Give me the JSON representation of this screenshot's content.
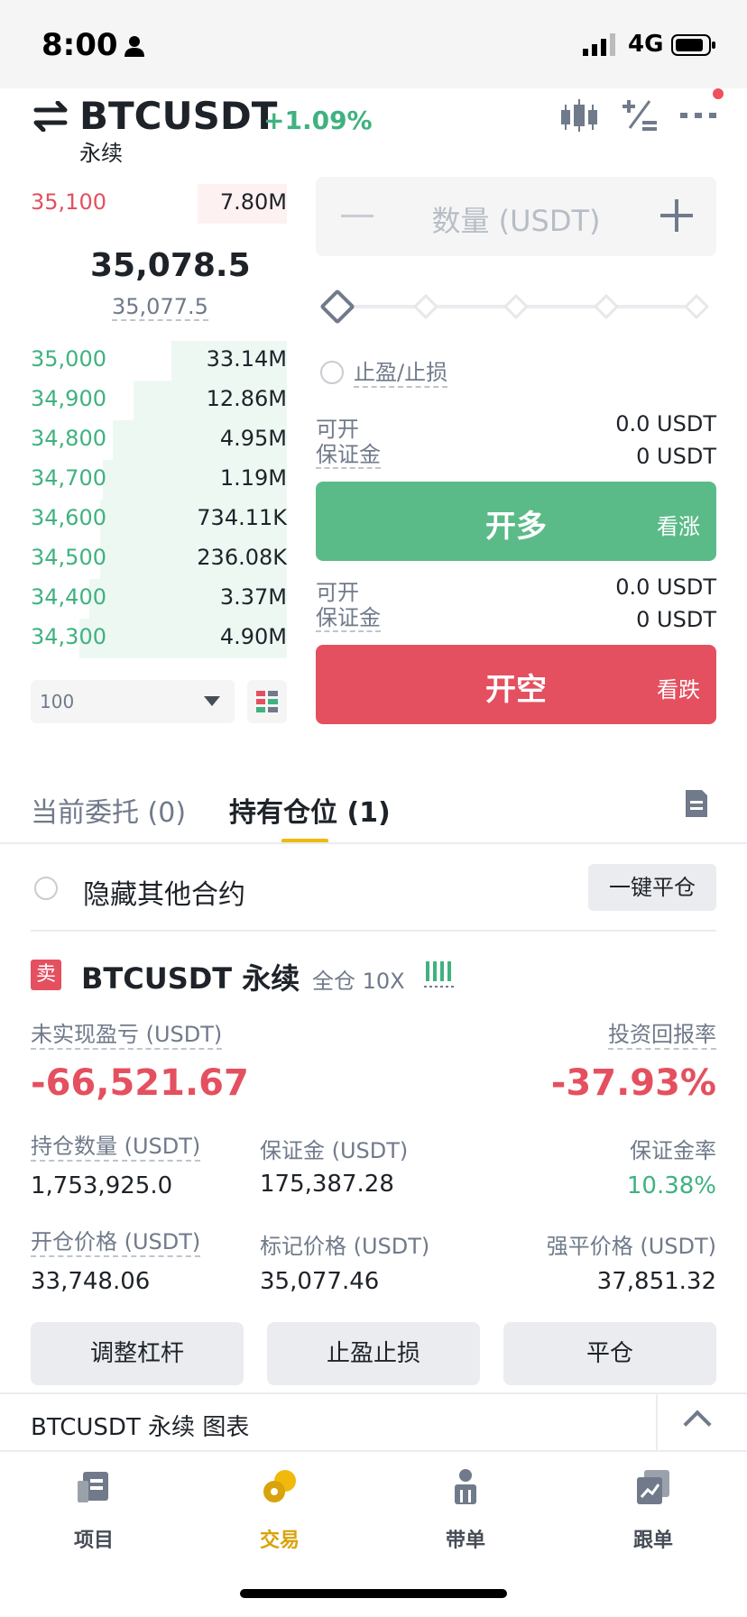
{
  "status_bar": {
    "time": "8:00",
    "network": "4G"
  },
  "header": {
    "symbol": "BTCUSDT",
    "change": "+1.09%",
    "contract_type": "永续"
  },
  "colors": {
    "green": "#3fb27f",
    "red": "#e4505f",
    "accent": "#f0b90b"
  },
  "order_book": {
    "asks": [
      {
        "price": "35,100",
        "qty": "7.80M",
        "depth": 0.5
      }
    ],
    "last_price": "35,078.5",
    "mark_price": "35,077.5",
    "bids": [
      {
        "price": "35,000",
        "qty": "33.14M",
        "depth": 0.45
      },
      {
        "price": "34,900",
        "qty": "12.86M",
        "depth": 0.6
      },
      {
        "price": "34,800",
        "qty": "4.95M",
        "depth": 0.68
      },
      {
        "price": "34,700",
        "qty": "1.19M",
        "depth": 0.72
      },
      {
        "price": "34,600",
        "qty": "734.11K",
        "depth": 0.73
      },
      {
        "price": "34,500",
        "qty": "236.08K",
        "depth": 0.73
      },
      {
        "price": "34,400",
        "qty": "3.37M",
        "depth": 0.77
      },
      {
        "price": "34,300",
        "qty": "4.90M",
        "depth": 0.81
      }
    ],
    "depth_value": "100"
  },
  "order_form": {
    "qty_placeholder": "数量 (USDT)",
    "tpsl_label": "止盈/止损",
    "long": {
      "available_label": "可开",
      "available_value": "0.0 USDT",
      "margin_label": "保证金",
      "margin_value": "0 USDT",
      "button_label": "开多",
      "button_sub": "看涨"
    },
    "short": {
      "available_label": "可开",
      "available_value": "0.0 USDT",
      "margin_label": "保证金",
      "margin_value": "0 USDT",
      "button_label": "开空",
      "button_sub": "看跌"
    }
  },
  "tabs": {
    "open_orders": "当前委托 (0)",
    "positions": "持有仓位 (1)"
  },
  "positions_panel": {
    "hide_others_label": "隐藏其他合约",
    "close_all_label": "一键平仓"
  },
  "position": {
    "side_badge": "卖",
    "symbol": "BTCUSDT 永续",
    "mode": "全仓 10X",
    "unrealized_pnl_label": "未实现盈亏 (USDT)",
    "unrealized_pnl": "-66,521.67",
    "roe_label": "投资回报率",
    "roe": "-37.93%",
    "size_label": "持仓数量 (USDT)",
    "size": "1,753,925.0",
    "margin_label": "保证金 (USDT)",
    "margin": "175,387.28",
    "margin_ratio_label": "保证金率",
    "margin_ratio": "10.38%",
    "entry_label": "开仓价格 (USDT)",
    "entry": "33,748.06",
    "mark_label": "标记价格 (USDT)",
    "mark": "35,077.46",
    "liq_label": "强平价格 (USDT)",
    "liq": "37,851.32",
    "actions": {
      "leverage": "调整杠杆",
      "tpsl": "止盈止损",
      "close": "平仓"
    }
  },
  "chart_bar": {
    "label": "BTCUSDT 永续  图表"
  },
  "bottom_nav": [
    {
      "label": "项目",
      "icon": "projects-icon"
    },
    {
      "label": "交易",
      "icon": "trade-icon"
    },
    {
      "label": "带单",
      "icon": "lead-trader-icon"
    },
    {
      "label": "跟单",
      "icon": "copy-trade-icon"
    }
  ]
}
